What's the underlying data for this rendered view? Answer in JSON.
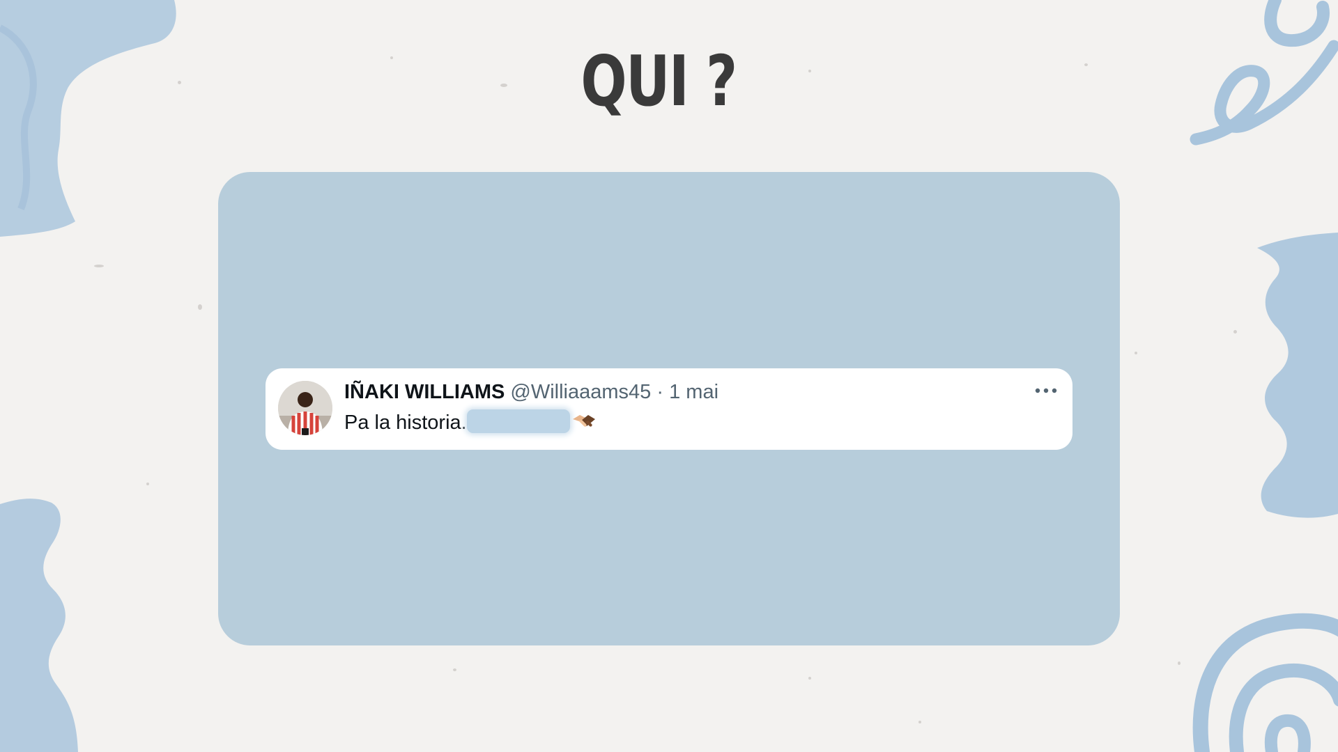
{
  "slide": {
    "title": "QUI ?",
    "background_color": "#f3f2f0",
    "panel_color": "#b7cddb",
    "decoration_color": "#a8c4dc"
  },
  "tweet": {
    "author_name": "IÑAKI WILLIAMS",
    "author_handle": "@Williaaams45",
    "separator": "·",
    "date": "1 mai",
    "text": "Pa la historia.",
    "avatar_icon": "avatar-photo-football-kit",
    "more_icon": "more-dots-icon",
    "redacted_segment": "blurred-redaction",
    "trailing_emoji": "handshake-icon"
  }
}
